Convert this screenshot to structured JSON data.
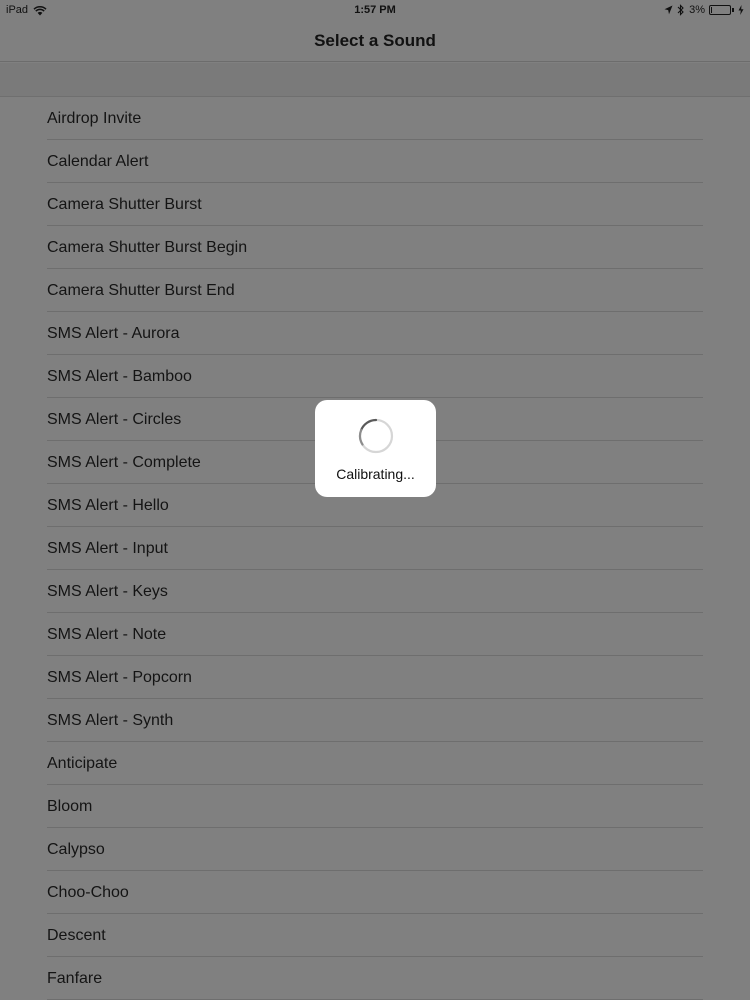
{
  "status_bar": {
    "device": "iPad",
    "time": "1:57 PM",
    "battery": "3%",
    "battery_level_percent": 3
  },
  "nav": {
    "title": "Select a Sound"
  },
  "sounds": [
    "Airdrop Invite",
    "Calendar Alert",
    "Camera Shutter Burst",
    "Camera Shutter Burst Begin",
    "Camera Shutter Burst End",
    "SMS Alert - Aurora",
    "SMS Alert - Bamboo",
    "SMS Alert - Circles",
    "SMS Alert - Complete",
    "SMS Alert - Hello",
    "SMS Alert - Input",
    "SMS Alert - Keys",
    "SMS Alert - Note",
    "SMS Alert - Popcorn",
    "SMS Alert - Synth",
    "Anticipate",
    "Bloom",
    "Calypso",
    "Choo-Choo",
    "Descent",
    "Fanfare"
  ],
  "hud": {
    "label": "Calibrating..."
  },
  "icons": {
    "wifi": "wifi-icon",
    "location": "location-arrow-icon",
    "bluetooth": "bluetooth-icon",
    "battery": "battery-icon",
    "charging": "charging-bolt-icon",
    "spinner": "activity-spinner-icon"
  }
}
